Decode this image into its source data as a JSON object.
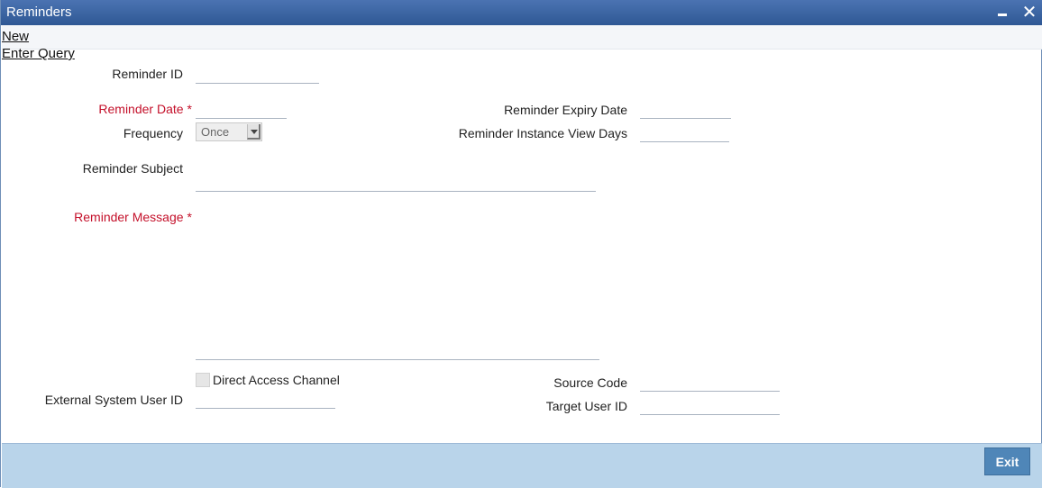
{
  "window": {
    "title": "Reminders",
    "minimize_icon": "minimize-icon",
    "close_icon": "close-icon",
    "close_glyph": "✕"
  },
  "menu": {
    "new_label": "New",
    "enter_query_label": "Enter Query"
  },
  "form": {
    "reminder_id": {
      "label": "Reminder ID",
      "value": ""
    },
    "reminder_date": {
      "label": "Reminder Date",
      "required_marker": "*",
      "value": ""
    },
    "reminder_expiry_date": {
      "label": "Reminder Expiry Date",
      "value": ""
    },
    "frequency": {
      "label": "Frequency",
      "selected": "Once"
    },
    "reminder_instance_view_days": {
      "label": "Reminder Instance View Days",
      "value": ""
    },
    "reminder_subject": {
      "label": "Reminder Subject",
      "value": ""
    },
    "reminder_message": {
      "label": "Reminder Message",
      "required_marker": "*",
      "value": ""
    },
    "direct_access_channel": {
      "label": "Direct Access Channel",
      "checked": false
    },
    "source_code": {
      "label": "Source Code",
      "value": ""
    },
    "external_system_user_id": {
      "label": "External System User ID",
      "value": ""
    },
    "target_user_id": {
      "label": "Target User ID",
      "value": ""
    }
  },
  "footer": {
    "exit_label": "Exit"
  },
  "colors": {
    "titlebar": "#3a63a3",
    "required_label": "#c4102a",
    "footer_bar": "#b9d4ea",
    "exit_button": "#4f86b8"
  }
}
